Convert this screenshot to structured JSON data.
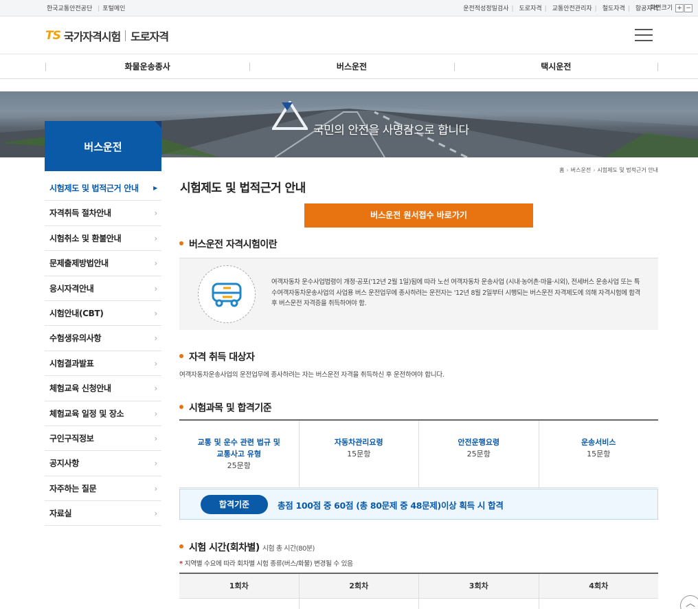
{
  "util": {
    "left": [
      "한국교통안전공단",
      "포털메인"
    ],
    "right": [
      "운전적성정밀검사",
      "도로자격",
      "교통안전관리자",
      "철도자격",
      "항공자격"
    ],
    "font_size_label": "화면크기",
    "font_plus": "+",
    "font_minus": "−"
  },
  "header": {
    "logo_ts": "TS",
    "logo_org": "국가자격시험",
    "logo_sub": "도로자격"
  },
  "gnb": [
    "화물운송종사",
    "버스운전",
    "택시운전"
  ],
  "banner": {
    "slogan": "국민의 안전을 사명감으로 합니다"
  },
  "side": {
    "title": "버스운전",
    "menu": [
      "시험제도 및 법적근거 안내",
      "자격취득 절차안내",
      "시험취소 및 환불안내",
      "문제출제방법안내",
      "응시자격안내",
      "시험안내(CBT)",
      "수험생유의사항",
      "시험결과발표",
      "체험교육 신청안내",
      "체험교육 일정 및 장소",
      "구인구직정보",
      "공지사항",
      "자주하는 질문",
      "자료실"
    ]
  },
  "breadcrumb": [
    "홈",
    "버스운전",
    "시험제도 및 법적근거 안내"
  ],
  "page_title": "시험제도 및 법적근거 안내",
  "apply_button": "버스운전 원서접수 바로가기",
  "section1": {
    "title": "버스운전 자격시험이란",
    "text": "여객자동차 운수사업법령이 개정·공포('12년 2월 1일)됨에 따라 노선 여객자동차 운송사업 (시내·농어촌·마을·시외), 전세버스 운송사업 또는 특수여객자동차운송사업의 사업용 버스 운전업무에 종사하려는 운전자는 '12년 8월 2일부터 시행되는 버스운전 자격제도에 의해 자격시험에 합격 후 버스운전 자격증을 취득하여야 함."
  },
  "section2": {
    "title": "자격 취득 대상자",
    "text": "여객자동차운송사업의 운전업무에 종사하려는 자는 버스운전 자격을 취득하신 후 운전하여야 합니다."
  },
  "section3": {
    "title": "시험과목 및 합격기준",
    "subjects": [
      {
        "name1": "교통 및 운수 관련 법규 및",
        "name2": "교통사고 유형",
        "count": "25문항"
      },
      {
        "name1": "자동차관리요령",
        "name2": "",
        "count": "15문항"
      },
      {
        "name1": "안전운행요령",
        "name2": "",
        "count": "25문항"
      },
      {
        "name1": "운송서비스",
        "name2": "",
        "count": "15문항"
      }
    ],
    "pass_badge": "합격기준",
    "pass_text": "총점 100점 중 60점 (총 80문제 중 48문제)이상 획득 시 합격"
  },
  "section4": {
    "title": "시험 시간(회차별)",
    "subtitle": "시험 총 시간(80분)",
    "note_mark": "*",
    "note": "지역별 수요에 따라 회차별 시험 종류(버스/화물) 변경될 수 있음",
    "rounds": [
      "1회차",
      "2회차",
      "3회차",
      "4회차"
    ]
  },
  "colors": {
    "primary": "#0a5aa8",
    "accent": "#e87411"
  }
}
